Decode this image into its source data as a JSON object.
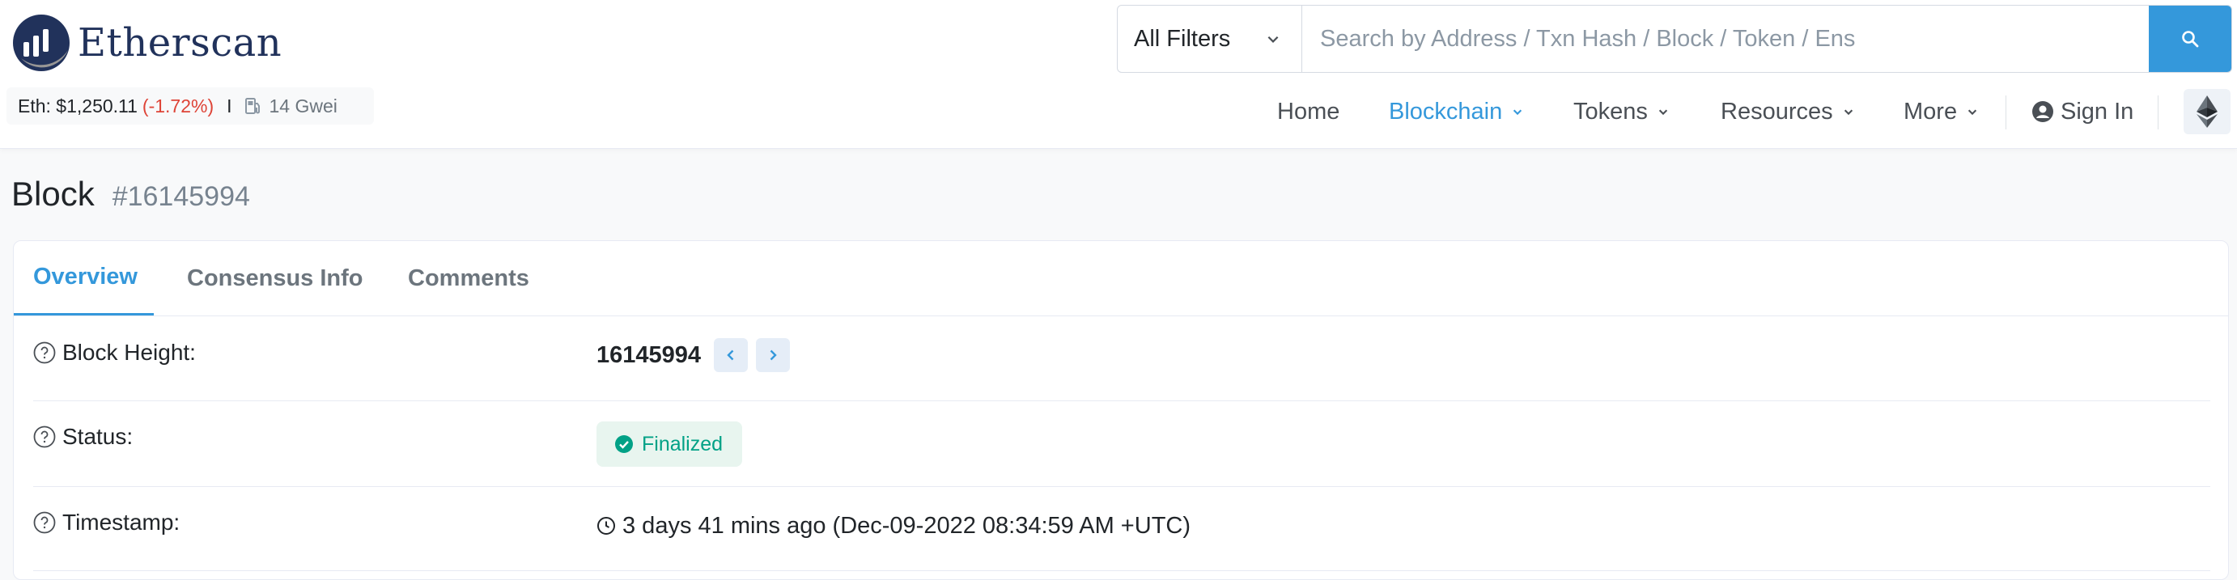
{
  "brand": {
    "name": "Etherscan"
  },
  "price": {
    "label": "Eth: $1,250.11",
    "change": "(-1.72%)",
    "separator": "I",
    "gas": "14 Gwei",
    "gas_icon": "gas-pump-icon"
  },
  "search": {
    "filter_label": "All Filters",
    "placeholder": "Search by Address / Txn Hash / Block / Token / Ens",
    "value": "",
    "button_icon": "search-icon"
  },
  "nav": {
    "home": "Home",
    "blockchain": "Blockchain",
    "tokens": "Tokens",
    "resources": "Resources",
    "more": "More",
    "sign_in": "Sign In",
    "network_icon": "ethereum-icon",
    "active": "Blockchain"
  },
  "page": {
    "title": "Block",
    "block_number": "#16145994"
  },
  "tabs": [
    {
      "label": "Overview",
      "active": true
    },
    {
      "label": "Consensus Info",
      "active": false
    },
    {
      "label": "Comments",
      "active": false
    }
  ],
  "overview": {
    "block_height": {
      "label": "Block Height:",
      "value": "16145994"
    },
    "status": {
      "label": "Status:",
      "value": "Finalized"
    },
    "timestamp": {
      "label": "Timestamp:",
      "value": "3 days 41 mins ago (Dec-09-2022 08:34:59 AM +UTC)"
    }
  },
  "colors": {
    "accent": "#3498db",
    "brand_navy": "#21325b",
    "negative": "#de4437",
    "success": "#00a186",
    "success_bg": "#e8f5ef"
  }
}
